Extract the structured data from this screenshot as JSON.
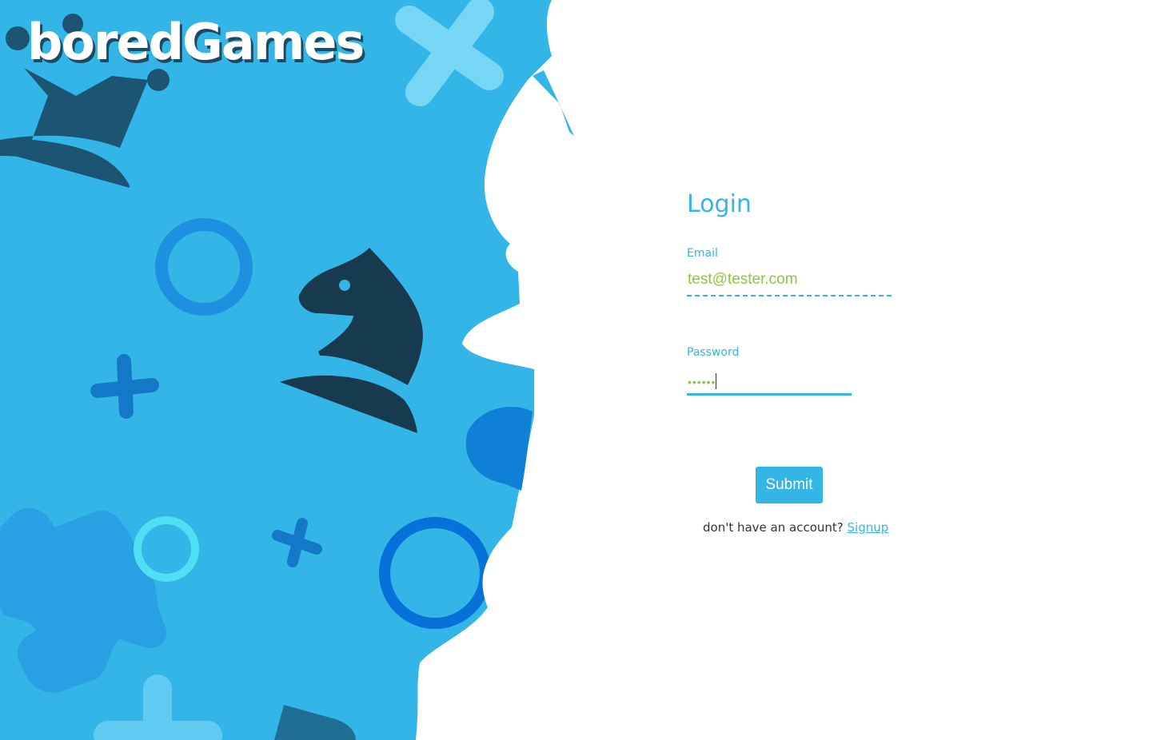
{
  "brand": {
    "logo_text": "boredGames"
  },
  "colors": {
    "background_blue": "#34b5e8",
    "accent_blue": "#34b5e8",
    "dark_navy": "#173a4f",
    "input_text_green": "#8cc63f"
  },
  "hero": {
    "decorations": [
      "crown-icon",
      "x-mark-icon",
      "circle-ring-icon",
      "plus-icon",
      "knight-chess-piece-icon",
      "puzzle-piece-icon",
      "bishop-silhouette"
    ]
  },
  "login": {
    "title": "Login",
    "email_label": "Email",
    "email_value": "test@tester.com",
    "password_label": "Password",
    "password_value": "••••••",
    "submit_label": "Submit",
    "signup_prompt": "don't have an account?",
    "signup_link": "Signup"
  }
}
